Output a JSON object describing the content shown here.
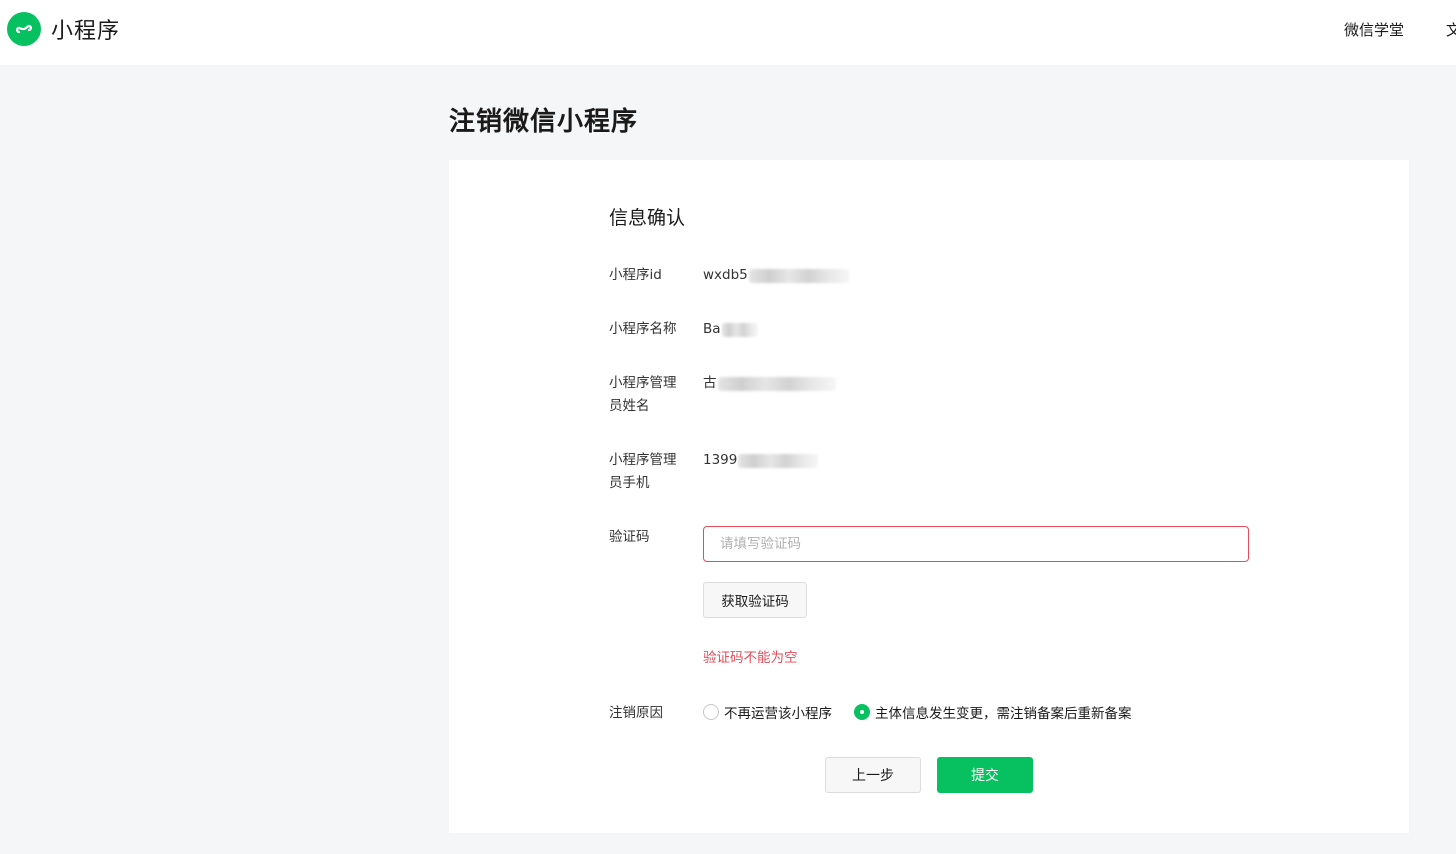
{
  "header": {
    "logo_text": "小程序",
    "nav": [
      "微信学堂",
      "文"
    ]
  },
  "page_title": "注销微信小程序",
  "form": {
    "section_title": "信息确认",
    "fields": {
      "app_id": {
        "label": "小程序id",
        "value": "wxdb5"
      },
      "app_name": {
        "label": "小程序名称",
        "value": "Ba"
      },
      "admin_name": {
        "label": "小程序管理员姓名",
        "value": "古"
      },
      "admin_phone": {
        "label": "小程序管理员手机",
        "value": "1399"
      }
    },
    "verify": {
      "label": "验证码",
      "placeholder": "请填写验证码",
      "value": "",
      "get_code_button": "获取验证码",
      "error": "验证码不能为空"
    },
    "reason": {
      "label": "注销原因",
      "options": [
        {
          "label": "不再运营该小程序",
          "selected": false
        },
        {
          "label": "主体信息发生变更，需注销备案后重新备案",
          "selected": true
        }
      ]
    },
    "buttons": {
      "prev": "上一步",
      "submit": "提交"
    }
  },
  "colors": {
    "brand": "#07c160",
    "error": "#e34d59",
    "background": "#f5f6f7"
  }
}
